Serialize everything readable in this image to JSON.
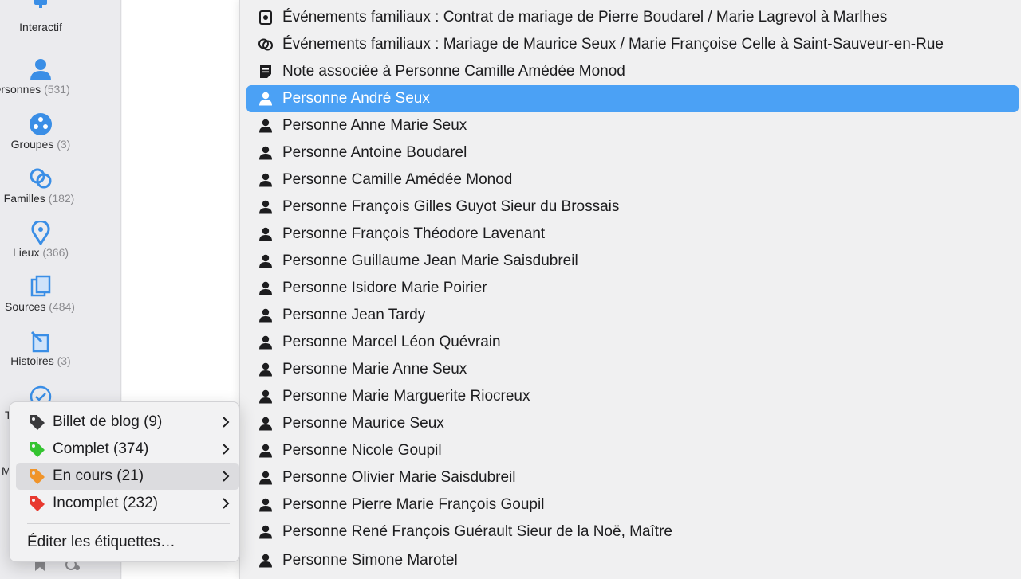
{
  "sidebar": {
    "items": [
      {
        "label": "Interactif",
        "count": "",
        "icon": "interactive-icon"
      },
      {
        "label": "Personnes",
        "count": "(531)",
        "icon": "person-icon"
      },
      {
        "label": "Groupes",
        "count": "(3)",
        "icon": "groups-icon"
      },
      {
        "label": "Familles",
        "count": "(182)",
        "icon": "families-icon"
      },
      {
        "label": "Lieux",
        "count": "(366)",
        "icon": "location-pin-icon"
      },
      {
        "label": "Sources",
        "count": "(484)",
        "icon": "sources-icon"
      },
      {
        "label": "Histoires",
        "count": "(3)",
        "icon": "stories-icon"
      }
    ],
    "partial_t": "T",
    "partial_m": "M"
  },
  "main_menu": {
    "items": [
      {
        "text": "Événements familiaux : Contrat de mariage de Pierre Boudarel / Marie Lagrevol à Marlhes",
        "icon": "contract-icon"
      },
      {
        "text": "Événements familiaux : Mariage de Maurice Seux / Marie Françoise Celle à Saint-Sauveur-en-Rue",
        "icon": "marriage-rings-icon"
      },
      {
        "text": "Note associée à Personne Camille Amédée Monod",
        "icon": "note-icon"
      },
      {
        "text": "Personne André Seux",
        "icon": "person-icon",
        "selected": true
      },
      {
        "text": "Personne Anne Marie Seux",
        "icon": "person-icon"
      },
      {
        "text": "Personne Antoine Boudarel",
        "icon": "person-icon"
      },
      {
        "text": "Personne Camille Amédée Monod",
        "icon": "person-icon"
      },
      {
        "text": "Personne François Gilles Guyot Sieur du Brossais",
        "icon": "person-icon"
      },
      {
        "text": "Personne François Théodore Lavenant",
        "icon": "person-icon"
      },
      {
        "text": "Personne Guillaume Jean Marie Saisdubreil",
        "icon": "person-icon"
      },
      {
        "text": "Personne Isidore Marie Poirier",
        "icon": "person-icon"
      },
      {
        "text": "Personne Jean Tardy",
        "icon": "person-icon"
      },
      {
        "text": "Personne Marcel Léon Quévrain",
        "icon": "person-icon"
      },
      {
        "text": "Personne Marie Anne Seux",
        "icon": "person-icon"
      },
      {
        "text": "Personne Marie Marguerite Riocreux",
        "icon": "person-icon"
      },
      {
        "text": "Personne Maurice Seux",
        "icon": "person-icon"
      },
      {
        "text": "Personne Nicole Goupil",
        "icon": "person-icon"
      },
      {
        "text": "Personne Olivier Marie Saisdubreil",
        "icon": "person-icon"
      },
      {
        "text": "Personne Pierre Marie François Goupil",
        "icon": "person-icon"
      },
      {
        "text": "Personne René François Guérault Sieur de la Noë, Maître",
        "icon": "person-icon"
      },
      {
        "text": "Personne Simone Marotel",
        "icon": "person-icon"
      }
    ]
  },
  "tag_menu": {
    "items": [
      {
        "label": "Billet de blog (9)",
        "color": "#3a3a3c",
        "icon": "tag-icon"
      },
      {
        "label": "Complet (374)",
        "color": "#34c430",
        "icon": "tag-icon"
      },
      {
        "label": "En cours (21)",
        "color": "#f0942a",
        "icon": "tag-icon",
        "hover": true
      },
      {
        "label": "Incomplet (232)",
        "color": "#e8392f",
        "icon": "tag-icon"
      }
    ],
    "edit_label": "Éditer les étiquettes…"
  },
  "colors": {
    "accent": "#4ba1f5",
    "sidebar_icon": "#3a8ee6"
  }
}
